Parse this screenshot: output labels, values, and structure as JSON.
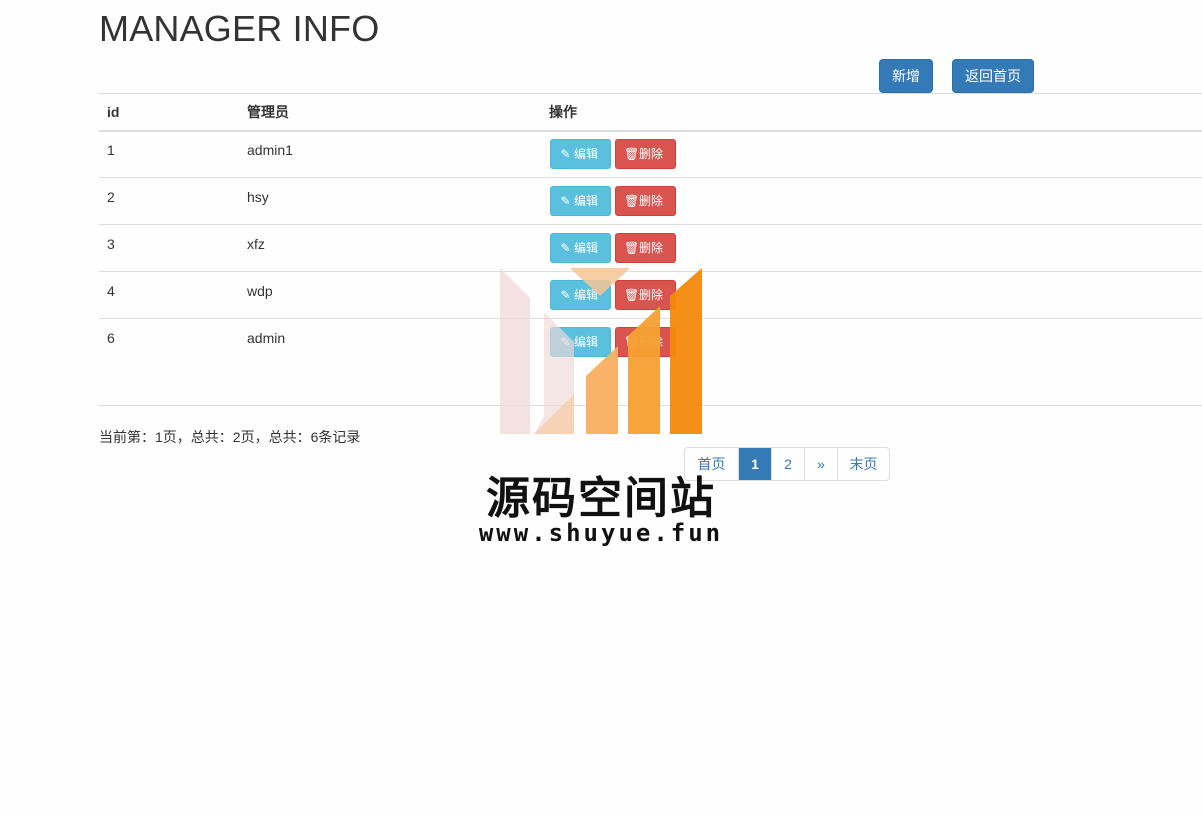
{
  "page": {
    "title": "MANAGER INFO"
  },
  "toolbar": {
    "add_label": "新增",
    "home_label": "返回首页"
  },
  "table": {
    "headers": {
      "id": "id",
      "name": "管理员",
      "ops": "操作"
    },
    "rows": [
      {
        "id": "1",
        "name": "admin1",
        "edit": "编辑",
        "delete": "删除"
      },
      {
        "id": "2",
        "name": "hsy",
        "edit": "编辑",
        "delete": "删除"
      },
      {
        "id": "3",
        "name": "xfz",
        "edit": "编辑",
        "delete": "删除"
      },
      {
        "id": "4",
        "name": "wdp",
        "edit": "编辑",
        "delete": "删除"
      },
      {
        "id": "6",
        "name": "admin",
        "edit": "编辑",
        "delete": "删除"
      }
    ]
  },
  "pager": {
    "info": "当前第：1页，总共：2页，总共：6条记录",
    "first": "首页",
    "pages": [
      "1",
      "2"
    ],
    "current": "1",
    "next": "»",
    "last": "末页"
  },
  "watermark": {
    "title": "源码空间站",
    "url": "www.shuyue.fun"
  },
  "colors": {
    "primary": "#337ab7",
    "info": "#5bc0de",
    "danger": "#d9534f",
    "watermark_orange": "#f58a0b"
  },
  "icons": {
    "edit": "pencil-icon",
    "delete": "trash-icon"
  }
}
